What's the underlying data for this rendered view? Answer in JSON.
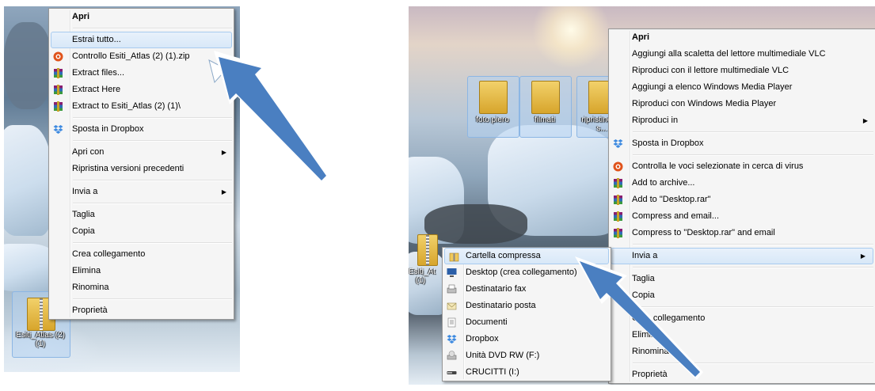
{
  "left": {
    "desktop_icon_label": "Esiti_Atlas (2) (1)",
    "menu": {
      "items": [
        {
          "label": "Apri",
          "bold": true,
          "icon": ""
        },
        {
          "sep": true
        },
        {
          "label": "Estrai tutto...",
          "highlighted": true,
          "icon": ""
        },
        {
          "label": "Controllo Esiti_Atlas (2) (1).zip",
          "icon": "antivirus-icon"
        },
        {
          "label": "Extract files...",
          "icon": "winrar-icon"
        },
        {
          "label": "Extract Here",
          "icon": "winrar-icon"
        },
        {
          "label": "Extract to Esiti_Atlas (2) (1)\\",
          "icon": "winrar-icon"
        },
        {
          "sep": true
        },
        {
          "label": "Sposta in Dropbox",
          "icon": "dropbox-icon"
        },
        {
          "sep": true
        },
        {
          "label": "Apri con",
          "submenu": true,
          "icon": ""
        },
        {
          "label": "Ripristina versioni precedenti",
          "icon": ""
        },
        {
          "sep": true
        },
        {
          "label": "Invia a",
          "submenu": true,
          "icon": ""
        },
        {
          "sep": true
        },
        {
          "label": "Taglia",
          "icon": ""
        },
        {
          "label": "Copia",
          "icon": ""
        },
        {
          "sep": true
        },
        {
          "label": "Crea collegamento",
          "icon": ""
        },
        {
          "label": "Elimina",
          "icon": ""
        },
        {
          "label": "Rinomina",
          "icon": ""
        },
        {
          "sep": true
        },
        {
          "label": "Proprietà",
          "icon": ""
        }
      ]
    }
  },
  "right": {
    "desktop_icons": [
      {
        "label": "foto piero"
      },
      {
        "label": "filmati"
      },
      {
        "label": "ripristino su s..."
      }
    ],
    "partial_icon_label": "Esiti_At (1)",
    "main_menu": {
      "items": [
        {
          "label": "Apri",
          "bold": true,
          "icon": ""
        },
        {
          "label": "Aggiungi alla scaletta del lettore multimediale VLC",
          "icon": ""
        },
        {
          "label": "Riproduci con il lettore multimediale VLC",
          "icon": ""
        },
        {
          "label": "Aggiungi a elenco Windows Media Player",
          "icon": ""
        },
        {
          "label": "Riproduci con Windows Media Player",
          "icon": ""
        },
        {
          "label": "Riproduci in",
          "submenu": true,
          "icon": ""
        },
        {
          "sep": true
        },
        {
          "label": "Sposta in Dropbox",
          "icon": "dropbox-icon"
        },
        {
          "sep": true
        },
        {
          "label": "Controlla le voci selezionate in cerca di virus",
          "icon": "antivirus-icon"
        },
        {
          "label": "Add to archive...",
          "icon": "winrar-icon"
        },
        {
          "label": "Add to \"Desktop.rar\"",
          "icon": "winrar-icon"
        },
        {
          "label": "Compress and email...",
          "icon": "winrar-icon"
        },
        {
          "label": "Compress to \"Desktop.rar\" and email",
          "icon": "winrar-icon"
        },
        {
          "sep": true
        },
        {
          "label": "Invia a",
          "submenu": true,
          "highlighted": true,
          "icon": ""
        },
        {
          "sep": true
        },
        {
          "label": "Taglia",
          "icon": ""
        },
        {
          "label": "Copia",
          "icon": ""
        },
        {
          "sep": true
        },
        {
          "label": "Crea collegamento",
          "icon": ""
        },
        {
          "label": "Elimina",
          "icon": ""
        },
        {
          "label": "Rinomina",
          "icon": ""
        },
        {
          "sep": true
        },
        {
          "label": "Proprietà",
          "icon": ""
        }
      ]
    },
    "submenu": {
      "items": [
        {
          "label": "Cartella compressa",
          "highlighted": true,
          "icon": "zip-folder-icon"
        },
        {
          "label": "Desktop (crea collegamento)",
          "icon": "desktop-icon"
        },
        {
          "label": "Destinatario fax",
          "icon": "fax-icon"
        },
        {
          "label": "Destinatario posta",
          "icon": "mail-icon"
        },
        {
          "label": "Documenti",
          "icon": "documents-icon"
        },
        {
          "label": "Dropbox",
          "icon": "dropbox-icon"
        },
        {
          "label": "Unità DVD RW (F:)",
          "icon": "dvd-drive-icon"
        },
        {
          "label": "CRUCITTI (I:)",
          "icon": "usb-drive-icon"
        }
      ]
    }
  },
  "colors": {
    "menu_bg": "#f5f5f5",
    "highlight": "#d8e8f8",
    "arrow_fill": "#4a7fc1",
    "arrow_outline": "#ffffff"
  }
}
